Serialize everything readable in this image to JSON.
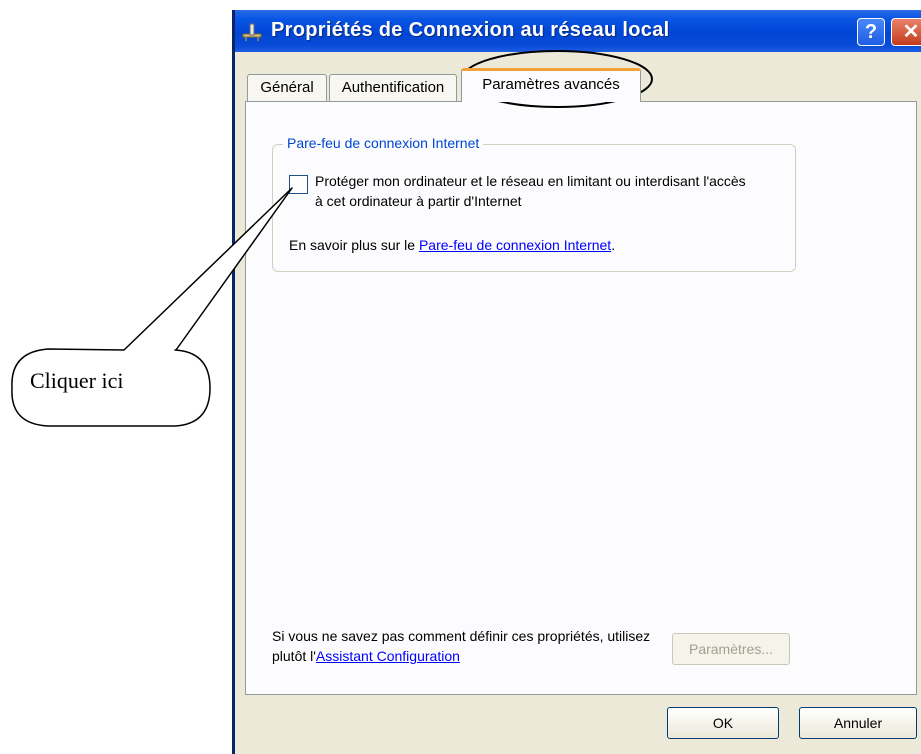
{
  "window": {
    "title": "Propriétés de Connexion au réseau local",
    "help_glyph": "?",
    "close_glyph": "✕"
  },
  "tabs": [
    {
      "label": "Général",
      "active": false
    },
    {
      "label": "Authentification",
      "active": false
    },
    {
      "label": "Paramètres avancés",
      "active": true
    }
  ],
  "firewall": {
    "group_title": "Pare-feu de connexion Internet",
    "checkbox_label": "Protéger mon ordinateur et le réseau en limitant ou interdisant l'accès à cet ordinateur à partir d'Internet",
    "checked": false,
    "learn_prefix": "En savoir plus sur le ",
    "learn_link": "Pare-feu de connexion Internet",
    "learn_suffix": "."
  },
  "assistant": {
    "text_prefix": "Si vous ne savez pas comment définir ces propriétés, utilisez plutôt l'",
    "link": "Assistant Configuration",
    "params_button": "Paramètres..."
  },
  "buttons": {
    "ok": "OK",
    "cancel": "Annuler"
  },
  "annotation": {
    "callout": "Cliquer ici"
  },
  "colors": {
    "titlebar": "#0046d5",
    "dialog_bg": "#ece9d8",
    "active_tab_accent": "#f3a136",
    "link": "#0000ff"
  }
}
